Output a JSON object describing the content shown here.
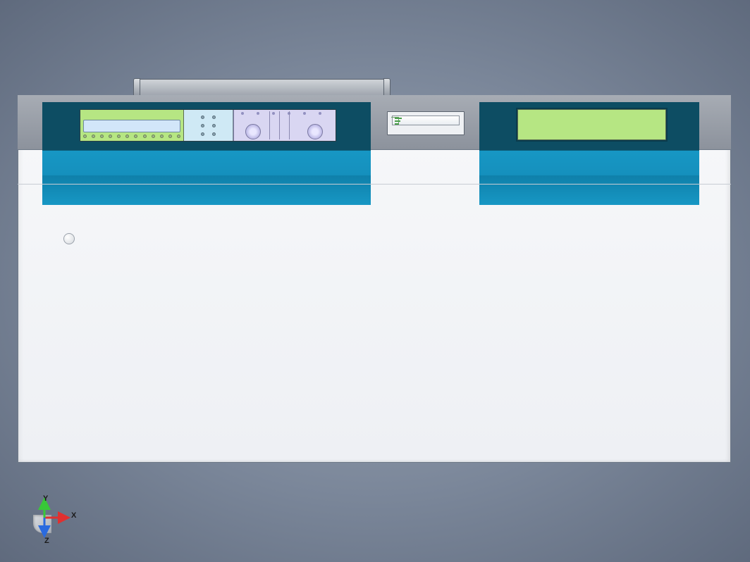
{
  "axes": {
    "x": "X",
    "y": "Y",
    "z": "Z"
  },
  "colors": {
    "x_axis": "#e03030",
    "y_axis": "#38c838",
    "z_axis": "#2a6adf",
    "teal": "#0d4d63",
    "blue": "#1797c4",
    "green_panel": "#b6e683",
    "purple_panel": "#d9d6f2",
    "light_blue_panel": "#cfe9f5"
  }
}
